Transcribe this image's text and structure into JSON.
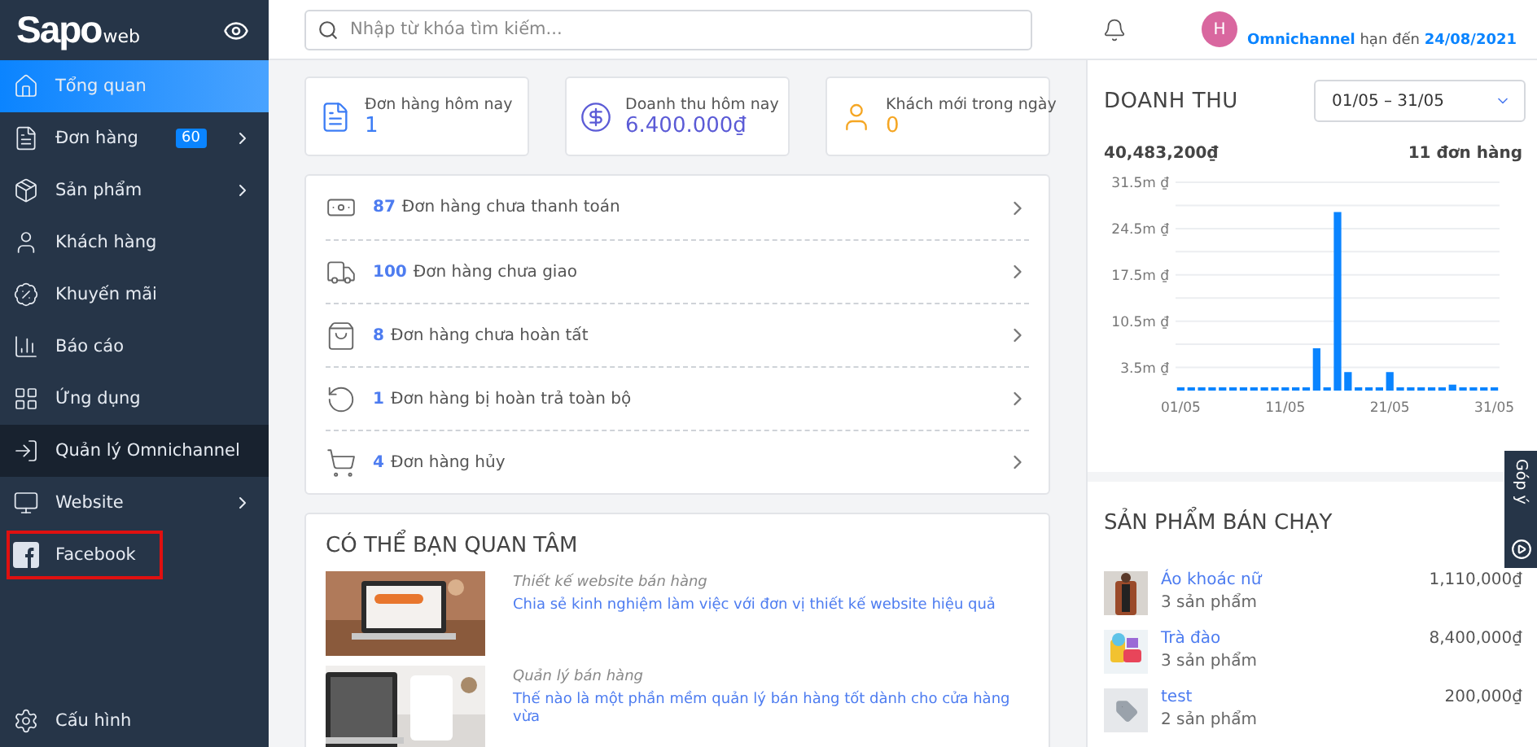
{
  "sidebar": {
    "logo": "Sapo",
    "logo_suffix": "web",
    "items": [
      {
        "label": "Tổng quan",
        "selected": true,
        "highlighted": false,
        "outlined": false,
        "has_children": false
      },
      {
        "label": "Đơn hàng",
        "badge": "60",
        "selected": false,
        "highlighted": false,
        "outlined": false,
        "has_children": true
      },
      {
        "label": "Sản phẩm",
        "selected": false,
        "highlighted": false,
        "outlined": false,
        "has_children": true
      },
      {
        "label": "Khách hàng",
        "selected": false,
        "highlighted": false,
        "outlined": false,
        "has_children": false
      },
      {
        "label": "Khuyến mãi",
        "selected": false,
        "highlighted": false,
        "outlined": false,
        "has_children": false
      },
      {
        "label": "Báo cáo",
        "selected": false,
        "highlighted": false,
        "outlined": false,
        "has_children": false
      },
      {
        "label": "Ứng dụng",
        "selected": false,
        "highlighted": false,
        "outlined": false,
        "has_children": false
      },
      {
        "label": "Quản lý Omnichannel",
        "selected": false,
        "highlighted": true,
        "outlined": false,
        "has_children": false
      },
      {
        "label": "Website",
        "selected": false,
        "highlighted": false,
        "outlined": false,
        "has_children": true
      },
      {
        "label": "Facebook",
        "selected": false,
        "highlighted": false,
        "outlined": true,
        "has_children": false
      }
    ],
    "settings": "Cấu hình"
  },
  "topbar": {
    "search": {
      "placeholder": "Nhập từ khóa tìm kiếm..."
    },
    "avatar": "H",
    "plan": "Omnichannel",
    "plan_text": "hạn đến",
    "expiry": "24/08/2021"
  },
  "stats": [
    {
      "label": "Đơn hàng hôm nay",
      "value": "1",
      "color": "#3b7cf5"
    },
    {
      "label": "Doanh thu hôm nay",
      "value": "6.400.000₫",
      "color": "#5b5bd6"
    },
    {
      "label": "Khách mới trong ngày",
      "value": "0",
      "color": "#f5a623"
    }
  ],
  "orders": [
    {
      "count": "87",
      "label": "Đơn hàng chưa thanh toán"
    },
    {
      "count": "100",
      "label": "Đơn hàng chưa giao"
    },
    {
      "count": "8",
      "label": "Đơn hàng chưa hoàn tất"
    },
    {
      "count": "1",
      "label": "Đơn hàng bị hoàn trả toàn bộ"
    },
    {
      "count": "4",
      "label": "Đơn hàng hủy"
    }
  ],
  "interest": {
    "title": "CÓ THỂ BẠN QUAN TÂM",
    "articles": [
      {
        "category": "Thiết kế website bán hàng",
        "title": "Chia sẻ kinh nghiệm làm việc với đơn vị thiết kế website hiệu quả"
      },
      {
        "category": "Quản lý bán hàng",
        "title": "Thế nào là một phần mềm quản lý bán hàng tốt dành cho cửa hàng vừa"
      }
    ]
  },
  "revenue": {
    "title": "DOANH THU",
    "range": "01/05 – 31/05",
    "total": "40,483,200₫",
    "orders": "11 đơn hàng",
    "chart_data": {
      "type": "bar",
      "categories": [
        "01/05",
        null,
        null,
        null,
        null,
        null,
        null,
        null,
        null,
        null,
        "11/05",
        null,
        null,
        null,
        null,
        null,
        null,
        null,
        null,
        null,
        "21/05",
        null,
        null,
        null,
        null,
        null,
        null,
        null,
        null,
        null,
        "31/05"
      ],
      "grid": true,
      "series": [
        {
          "color": "#0a84ff",
          "values": [
            0,
            0,
            0,
            0,
            0,
            0,
            0,
            0,
            0,
            0,
            0,
            0,
            0,
            6.4,
            0,
            27,
            2.8,
            0,
            0,
            0,
            2.8,
            0,
            0,
            0,
            0,
            0,
            0.9,
            0,
            0,
            0,
            0
          ]
        }
      ],
      "yticks": [
        {
          "value": 3.5,
          "label": "3.5m ₫"
        },
        {
          "value": 10.5,
          "label": "10.5m ₫"
        },
        {
          "value": 17.5,
          "label": "17.5m ₫"
        },
        {
          "value": 24.5,
          "label": "24.5m ₫"
        },
        {
          "value": 31.5,
          "label": "31.5m ₫"
        }
      ],
      "ylim": [
        0,
        31.5
      ]
    }
  },
  "bestsellers": {
    "title": "SẢN PHẨM BÁN CHẠY",
    "items": [
      {
        "name": "Áo khoác nữ",
        "qty": "3 sản phẩm",
        "amount": "1,110,000₫",
        "kind": "picture"
      },
      {
        "name": "Trà đào",
        "qty": "3 sản phẩm",
        "amount": "8,400,000₫",
        "kind": "picture"
      },
      {
        "name": "test",
        "qty": "2 sản phẩm",
        "amount": "200,000₫",
        "kind": "placeholder"
      }
    ]
  },
  "feedback": "Góp ý"
}
